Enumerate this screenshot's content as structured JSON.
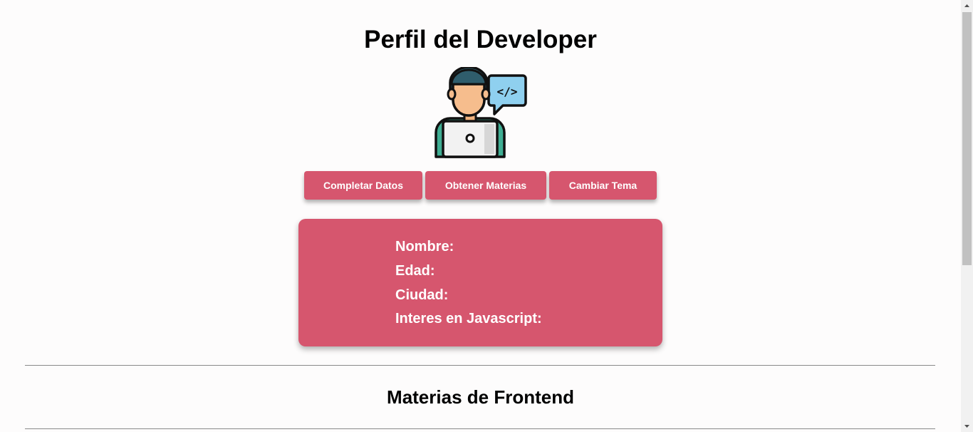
{
  "header": {
    "title": "Perfil del Developer"
  },
  "avatar": {
    "icon": "developer-laptop-icon",
    "code_symbol": "</>"
  },
  "buttons": {
    "complete_data": "Completar Datos",
    "get_subjects": "Obtener Materias",
    "change_theme": "Cambiar Tema"
  },
  "profile_card": {
    "name_label": "Nombre:",
    "age_label": "Edad:",
    "city_label": "Ciudad:",
    "js_interest_label": "Interes en Javascript:"
  },
  "subjects": {
    "title": "Materias de Frontend"
  },
  "colors": {
    "accent": "#d6566e",
    "background": "#fdfcfc"
  }
}
